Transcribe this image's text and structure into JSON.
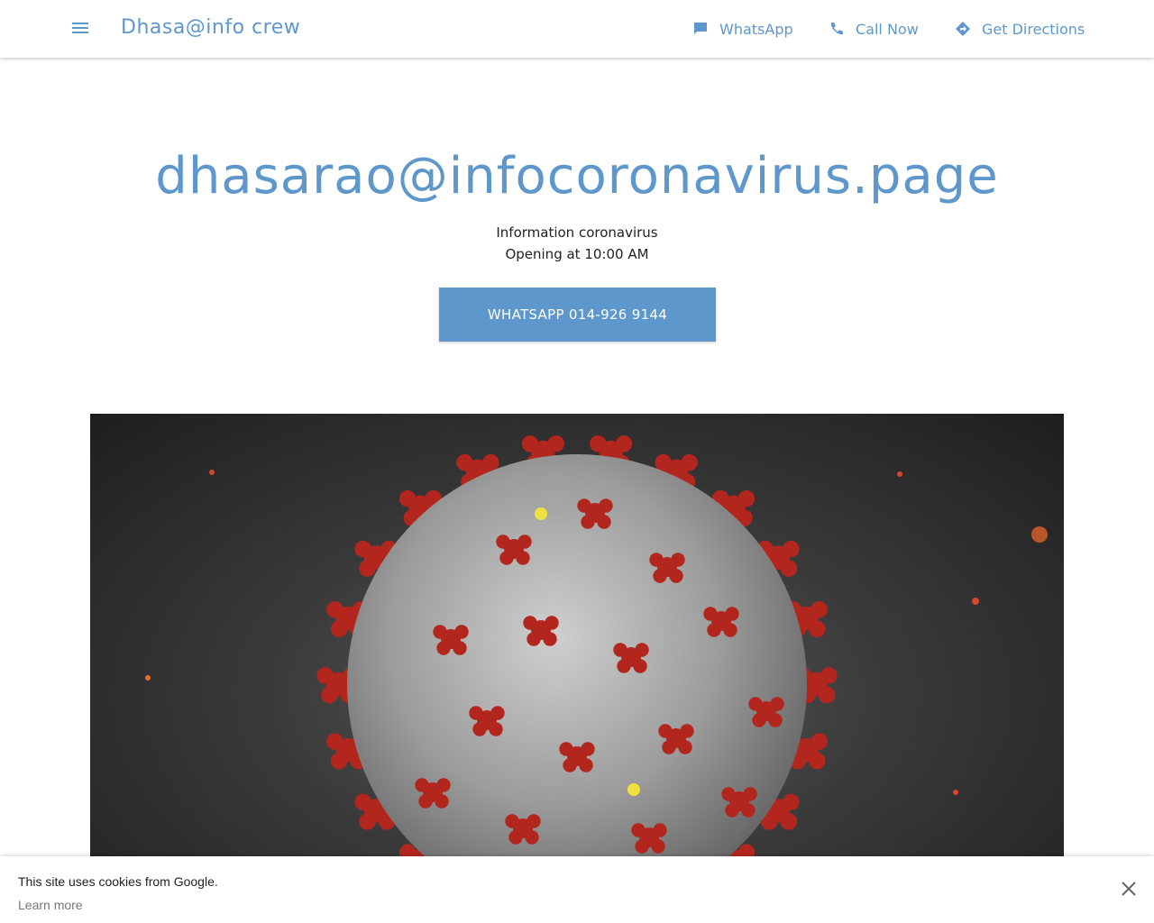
{
  "header": {
    "brand": "Dhasa@info crew",
    "actions": [
      {
        "label": "WhatsApp",
        "icon": "chat-icon"
      },
      {
        "label": "Call Now",
        "icon": "phone-icon"
      },
      {
        "label": "Get Directions",
        "icon": "directions-icon"
      }
    ]
  },
  "hero": {
    "title": "dhasarao@infocoronavirus.page",
    "subtitle": "Information coronavirus",
    "hours": "Opening at 10:00 AM",
    "cta_label": "WHATSAPP 014-926 9144"
  },
  "cookie_banner": {
    "text": "This site uses cookies from Google.",
    "link": "Learn more"
  },
  "colors": {
    "accent": "#5e97cc",
    "spike": "#b3261e",
    "virus_body": "#a8a8a8"
  }
}
